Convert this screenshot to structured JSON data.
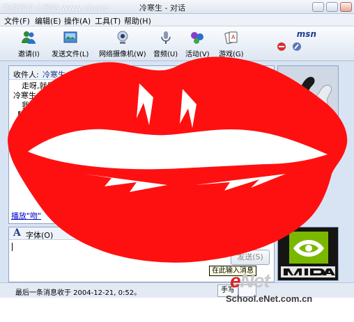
{
  "window": {
    "watermark": "新浪网个人网站 www.cheng",
    "title": "冷寒生 - 对话"
  },
  "menu": [
    "文件(F)",
    "编辑(E)",
    "操作(A)",
    "工具(T)",
    "帮助(H)"
  ],
  "toolbar": {
    "items": [
      {
        "label": "邀请(I)",
        "icon": "invite-icon"
      },
      {
        "label": "发送文件(L)",
        "icon": "send-file-icon"
      },
      {
        "label": "网络摄像机(W)",
        "icon": "webcam-icon"
      },
      {
        "label": "音频(U)",
        "icon": "audio-icon"
      },
      {
        "label": "活动(V)",
        "icon": "activity-icon"
      },
      {
        "label": "游戏(G)",
        "icon": "games-icon"
      }
    ],
    "brand": "msn"
  },
  "chat": {
    "to_label": "收件人:",
    "to_name": "冷寒生 <p",
    "messages": [
      "走呀,就是爱",
      "冷寒生 说:",
      "我这边还",
      "【谭"
    ],
    "play_link": "播放\"吻\""
  },
  "input": {
    "font_glyph": "A",
    "font_label": "字体(O)",
    "send_label": "发送(S)",
    "tooltip": "在此输入消息"
  },
  "status": {
    "last_message": "最后一条消息收于 2004-12-21, 0:52。",
    "handwrite_label": "手写"
  },
  "watermark_logo": {
    "brand_e": "e",
    "brand_rest": "Net",
    "site": "School.eNet.com.cn"
  },
  "colors": {
    "lips": "#ff1010",
    "accent": "#203a8a"
  }
}
